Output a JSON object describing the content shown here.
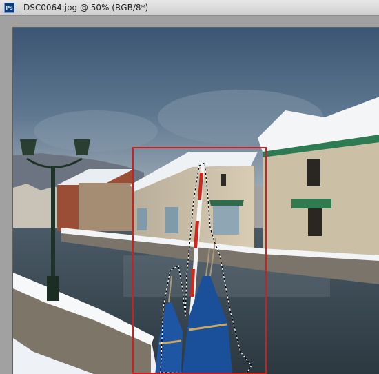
{
  "window": {
    "app_badge": "Ps",
    "title": "_DSC0064.jpg @ 50% (RGB/8*)"
  },
  "photo": {
    "subject": "snowy canal with warehouses, lamp post and blue-wrapped bundles",
    "sky_color": "#4d6682",
    "water_color": "#3c4c58"
  },
  "selection": {
    "type": "rectangle",
    "color": "#d41c1c"
  },
  "marquee": {
    "type": "lasso-marching-ants"
  }
}
